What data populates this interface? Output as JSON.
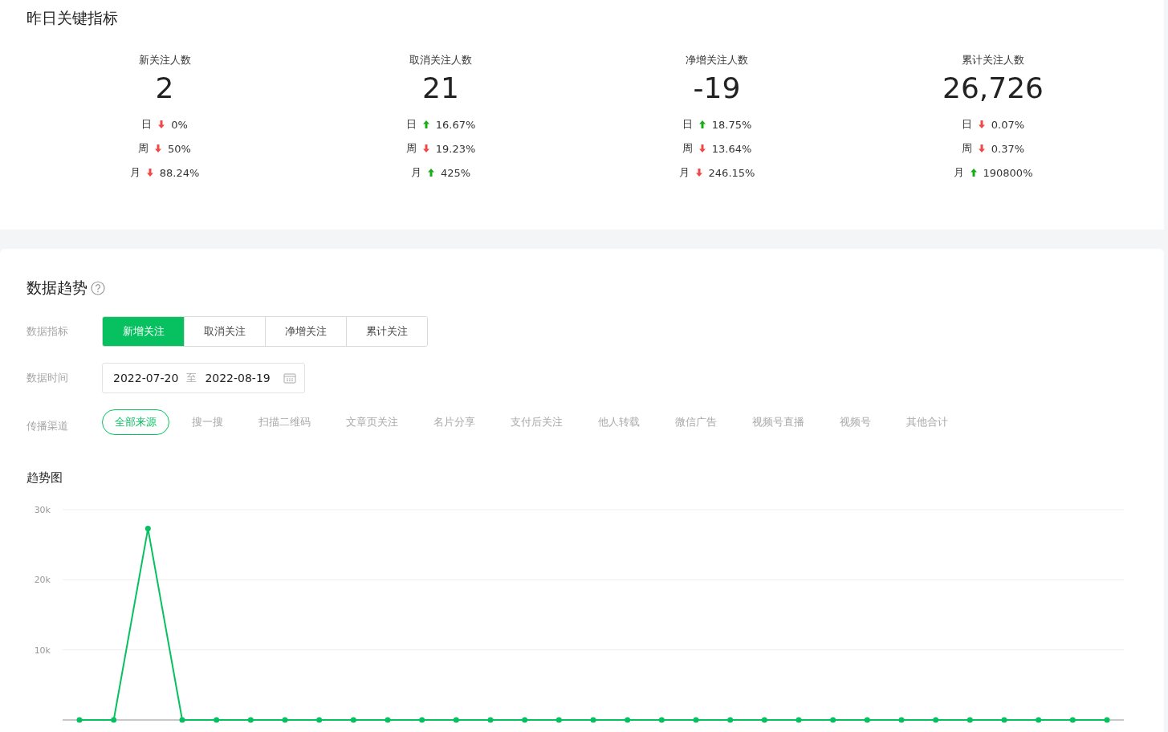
{
  "summary": {
    "title": "昨日关键指标",
    "metrics": [
      {
        "label": "新关注人数",
        "value": "2",
        "changes": [
          {
            "period": "日",
            "kind": "down",
            "value": "0%"
          },
          {
            "period": "周",
            "kind": "down",
            "value": "50%"
          },
          {
            "period": "月",
            "kind": "down",
            "value": "88.24%"
          }
        ]
      },
      {
        "label": "取消关注人数",
        "value": "21",
        "changes": [
          {
            "period": "日",
            "kind": "up",
            "value": "16.67%"
          },
          {
            "period": "周",
            "kind": "down",
            "value": "19.23%"
          },
          {
            "period": "月",
            "kind": "up",
            "value": "425%"
          }
        ]
      },
      {
        "label": "净增关注人数",
        "value": "-19",
        "changes": [
          {
            "period": "日",
            "kind": "up",
            "value": "18.75%"
          },
          {
            "period": "周",
            "kind": "down",
            "value": "13.64%"
          },
          {
            "period": "月",
            "kind": "down",
            "value": "246.15%"
          }
        ]
      },
      {
        "label": "累计关注人数",
        "value": "26,726",
        "changes": [
          {
            "period": "日",
            "kind": "down",
            "value": "0.07%"
          },
          {
            "period": "周",
            "kind": "down",
            "value": "0.37%"
          },
          {
            "period": "月",
            "kind": "up",
            "value": "190800%"
          }
        ]
      }
    ]
  },
  "trend": {
    "title": "数据趋势",
    "metric_label": "数据指标",
    "metric_tabs": [
      {
        "label": "新增关注",
        "selected": true
      },
      {
        "label": "取消关注",
        "selected": false
      },
      {
        "label": "净增关注",
        "selected": false
      },
      {
        "label": "累计关注",
        "selected": false
      }
    ],
    "date_label": "数据时间",
    "date_range": {
      "start": "2022-07-20",
      "separator": "至",
      "end": "2022-08-19"
    },
    "channel_label": "传播渠道",
    "channels": [
      {
        "label": "全部来源",
        "selected": true
      },
      {
        "label": "搜一搜",
        "selected": false
      },
      {
        "label": "扫描二维码",
        "selected": false
      },
      {
        "label": "文章页关注",
        "selected": false
      },
      {
        "label": "名片分享",
        "selected": false
      },
      {
        "label": "支付后关注",
        "selected": false
      },
      {
        "label": "他人转载",
        "selected": false
      },
      {
        "label": "微信广告",
        "selected": false
      },
      {
        "label": "视频号直播",
        "selected": false
      },
      {
        "label": "视频号",
        "selected": false
      },
      {
        "label": "其他合计",
        "selected": false
      }
    ],
    "chart_title": "趋势图",
    "chart_data": {
      "type": "line",
      "ylim": [
        0,
        30000
      ],
      "yticks": [
        {
          "value": 10000,
          "label": "10k"
        },
        {
          "value": 20000,
          "label": "20k"
        },
        {
          "value": 30000,
          "label": "30k"
        }
      ],
      "series": [
        {
          "color": "#07c160",
          "marker": true,
          "values": [
            0,
            0,
            27300,
            0,
            0,
            0,
            0,
            0,
            0,
            0,
            0,
            0,
            0,
            0,
            0,
            0,
            0,
            0,
            0,
            0,
            0,
            0,
            0,
            0,
            0,
            0,
            0,
            0,
            0,
            0,
            0
          ]
        }
      ]
    }
  }
}
